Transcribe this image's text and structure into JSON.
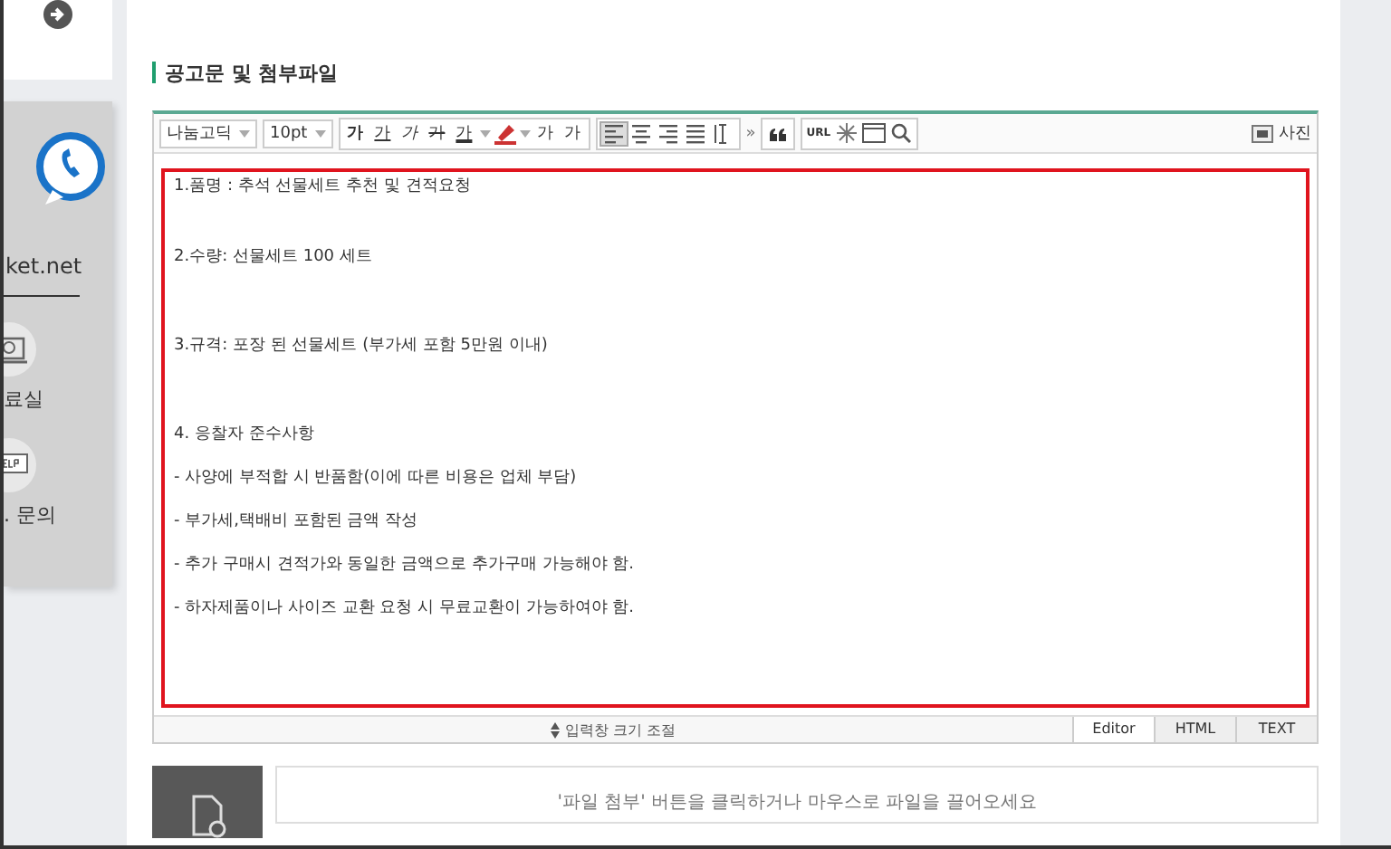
{
  "sidebar": {
    "site_text": "ket.net",
    "items": [
      {
        "kind": "pdf",
        "label": "료실"
      },
      {
        "kind": "help",
        "label": ". 문의"
      }
    ]
  },
  "section": {
    "title": "공고문 및 첨부파일"
  },
  "toolbar": {
    "font": "나눔고딕",
    "size": "10pt",
    "format_buttons": [
      {
        "kind": "bold",
        "label": "가"
      },
      {
        "kind": "underline",
        "label": "가"
      },
      {
        "kind": "italic",
        "label": "가"
      },
      {
        "kind": "strike",
        "label": "가"
      },
      {
        "kind": "color",
        "label": "가"
      },
      {
        "kind": "highlight"
      },
      {
        "kind": "sup",
        "label": "가"
      },
      {
        "kind": "sub",
        "label": "가"
      }
    ],
    "align_buttons": [
      {
        "kind": "left",
        "selected": true
      },
      {
        "kind": "center",
        "selected": false
      },
      {
        "kind": "right",
        "selected": false
      },
      {
        "kind": "justify",
        "selected": false
      },
      {
        "kind": "lineheight",
        "selected": false
      }
    ],
    "more": "»",
    "url": "URL",
    "photo": "사진"
  },
  "content": [
    "1.품명 : 추석 선물세트 추천 및 견적요청",
    "2.수량: 선물세트 100 세트",
    "3.규격: 포장 된 선물세트 (부가세 포함 5만원 이내)",
    "4. 응찰자 준수사항",
    "- 사양에 부적합 시 반품함(이에 따른 비용은 업체 부담)",
    "- 부가세,택배비 포함된 금액 작성",
    "- 추가 구매시 견적가와 동일한 금액으로 추가구매 가능해야 함.",
    "- 하자제품이나 사이즈 교환 요청 시 무료교환이 가능하여야 함."
  ],
  "resize_label": "입력창 크기 조절",
  "modes": [
    {
      "label": "Editor",
      "selected": true
    },
    {
      "label": "HTML",
      "selected": false
    },
    {
      "label": "TEXT",
      "selected": false
    }
  ],
  "upload_hint": "'파일 첨부' 버튼을 클릭하거나 마우스로 파일을 끌어오세요"
}
